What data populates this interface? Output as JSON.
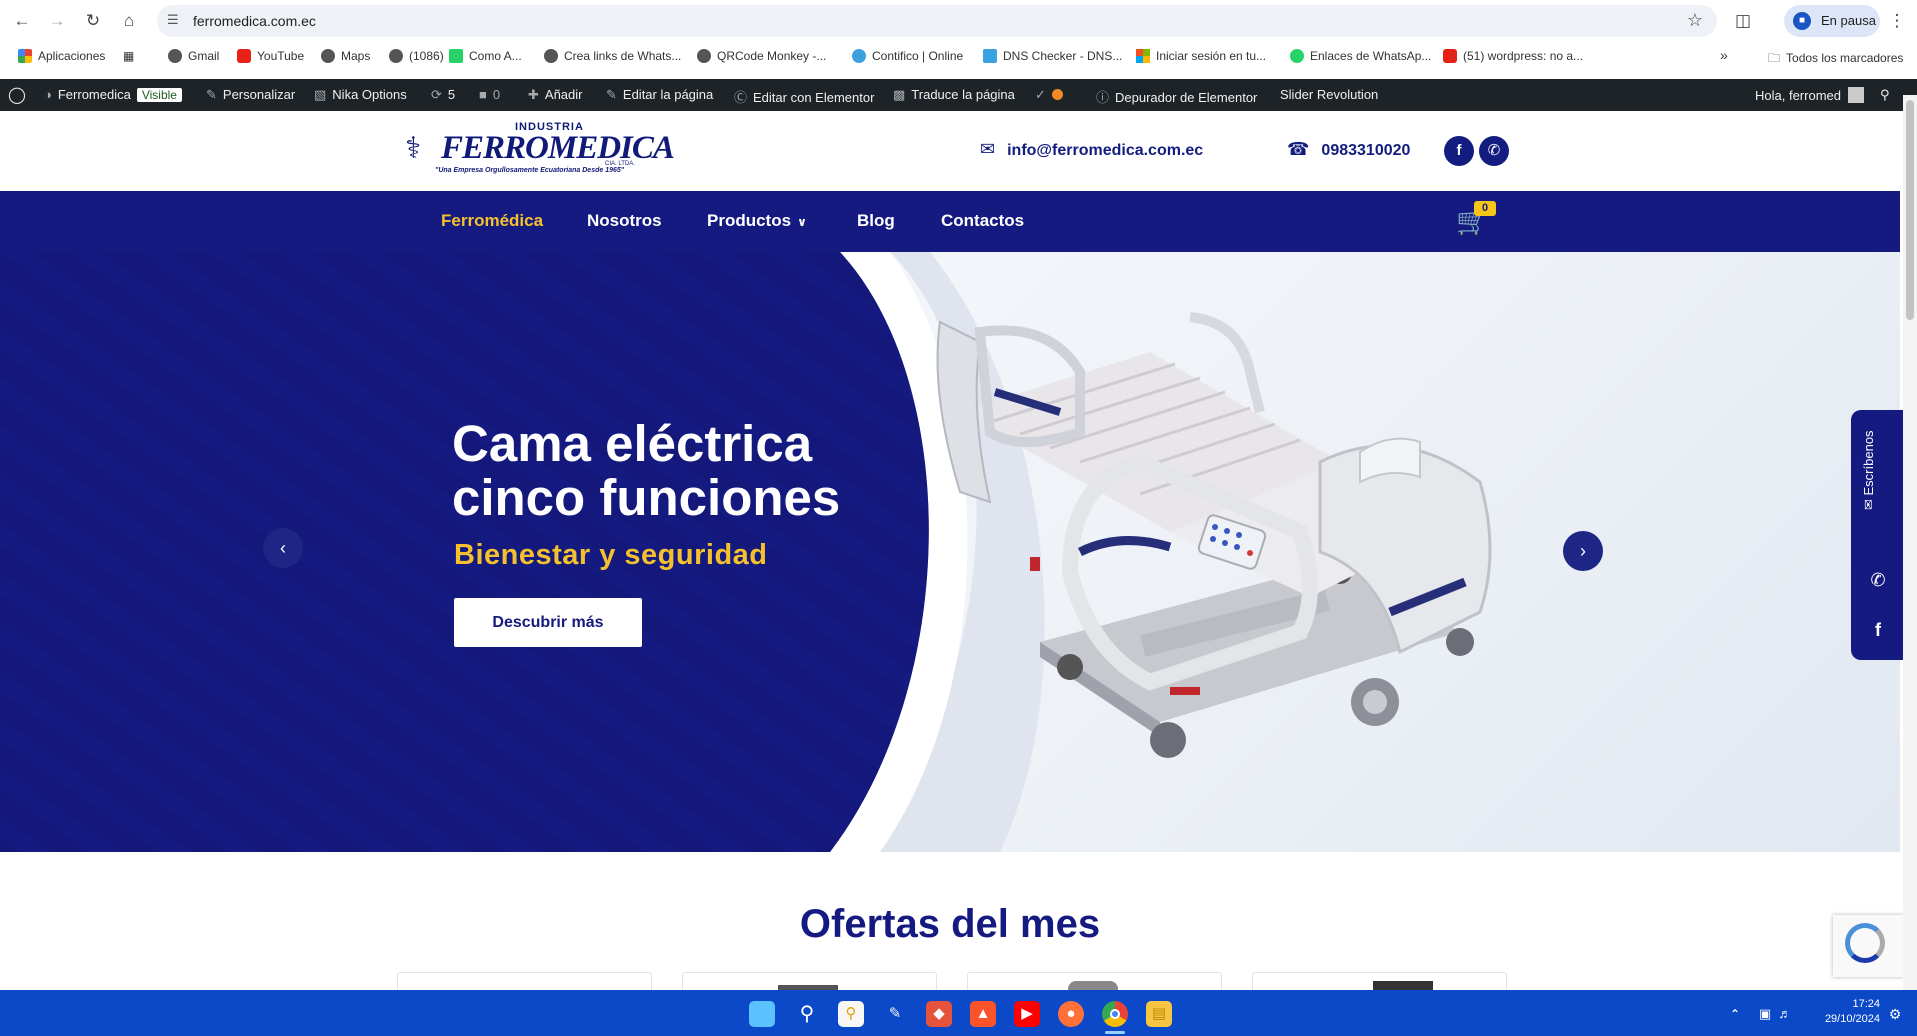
{
  "browser": {
    "url": "ferromedica.com.ec",
    "pause_label": "En pausa",
    "all_bookmarks_label": "Todos los marcadores",
    "bookmarks": [
      {
        "label": "Aplicaciones",
        "color": "#4285f4"
      },
      {
        "label": "Gmail",
        "color": "#555555"
      },
      {
        "label": "YouTube",
        "color": "#e62117"
      },
      {
        "label": "Maps",
        "color": "#555555"
      },
      {
        "label": "(1086)",
        "color": "#555555"
      },
      {
        "label": "Como A...",
        "color": "#25d366"
      },
      {
        "label": "Crea links de Whats...",
        "color": "#555555"
      },
      {
        "label": "QRCode Monkey -...",
        "color": "#555555"
      },
      {
        "label": "Contifico | Online",
        "color": "#3ba0e0"
      },
      {
        "label": "DNS Checker - DNS...",
        "color": "#3ba0e0"
      },
      {
        "label": "Iniciar sesión en tu...",
        "color": "#f25022"
      },
      {
        "label": "Enlaces de WhatsAp...",
        "color": "#25d366"
      },
      {
        "label": "(51) wordpress: no a...",
        "color": "#e62117"
      }
    ]
  },
  "wpbar": {
    "site": "Ferromedica",
    "visible": "Visible",
    "customize": "Personalizar",
    "nika": "Nika Options",
    "updates": "5",
    "comments": "0",
    "add": "Añadir",
    "edit_page": "Editar la página",
    "elementor": "Editar con Elementor",
    "translate": "Traduce la página",
    "debugger": "Depurador de Elementor",
    "slider": "Slider Revolution",
    "greeting": "Hola, ferromed"
  },
  "header": {
    "logo_industria": "INDUSTRIA",
    "logo_name": "FERROMEDICA",
    "logo_cia": "CIA. LTDA.",
    "logo_slogan": "\"Una Empresa Orgullosamente Ecuatoriana Desde 1965\"",
    "email": "info@ferromedica.com.ec",
    "phone": "0983310020"
  },
  "nav": {
    "items": [
      "Ferromédica",
      "Nosotros",
      "Productos",
      "Blog",
      "Contactos"
    ],
    "active_color": "#f5c02e",
    "cart_count": "0"
  },
  "hero": {
    "title": "Cama eléctrica cinco funciones",
    "subtitle": "Bienestar y seguridad",
    "button": "Descubrir más"
  },
  "side_tab": {
    "label": "Escríbenos"
  },
  "offers": {
    "title": "Ofertas del mes"
  },
  "taskbar": {
    "time": "17:24",
    "date": "29/10/2024"
  },
  "colors": {
    "brand_blue": "#151a80",
    "accent_yellow": "#f5c02e"
  }
}
